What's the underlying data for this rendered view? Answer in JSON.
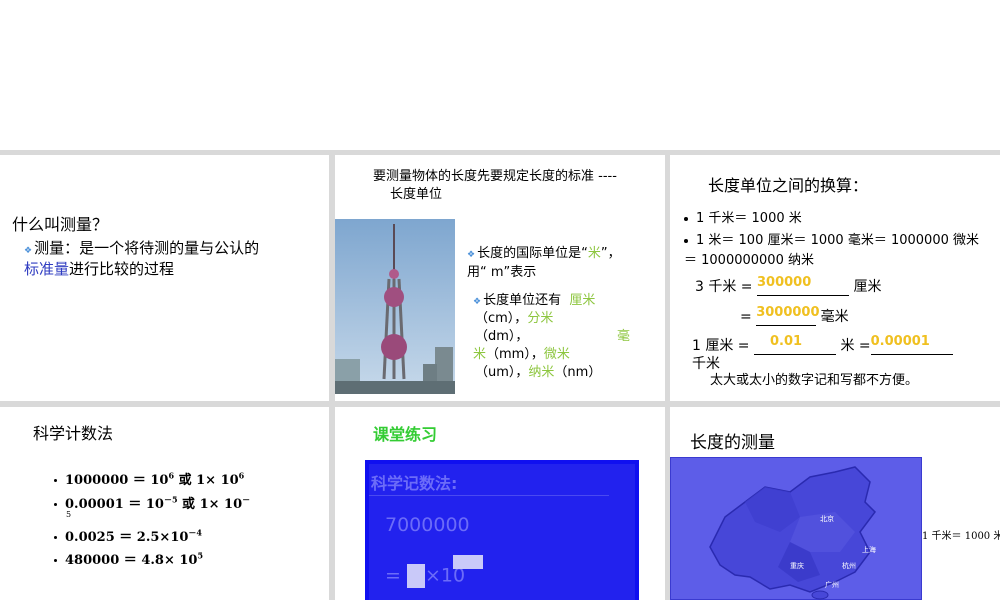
{
  "colors": {
    "accent_green": "#8dc63f",
    "link_blue": "#2f3cc1",
    "fill_yellow": "#f0c020",
    "heading_green": "#33cc33",
    "panel_blue": "#1010f0"
  },
  "slide1": {
    "title": "什么叫测量？",
    "line1": "测量：是一个将待测的量与公认的",
    "highlight": "标准量",
    "line2_rest": "进行比较的过程"
  },
  "slide2": {
    "header_line1": "要测量物体的长度先要规定长度的标准 ----",
    "header_line2": "长度单位",
    "photo_icon": "tv-tower-photo",
    "unit_intro_a": "长度的国际单位是“",
    "unit_intro_mi": "米",
    "unit_intro_b": "”，",
    "unit_intro_c": "用“ m”表示",
    "more_units": "长度单位还有",
    "cm_cn": "厘米",
    "cm_en": "（cm），",
    "dm_cn": "分米",
    "dm_en": "（dm），",
    "mm_cn_a": "毫",
    "mm_cn_b": "米",
    "mm_en": "（mm），",
    "um_cn": "微米",
    "um_en": "（um），",
    "nm_cn": "纳米",
    "nm_en": "（nm）"
  },
  "slide3": {
    "title": "长度单位之间的换算：",
    "item1": "1 千米＝ 1000 米",
    "item2a": "1 米＝ 100 厘米＝ 1000 毫米＝ 1000000 微米",
    "item2b": "＝ 1000000000 纳米",
    "q1_prefix": "3 千米 =",
    "q1_answer": "300000",
    "q1_unit": "厘米",
    "q2_prefix": "=",
    "q2_answer": "3000000",
    "q2_unit": "毫米",
    "q3_prefix": "1 厘米 =",
    "q3_answer1": "0.01",
    "q3_mid": "米 =",
    "q3_answer2": "0.00001",
    "q3_unit": "千米",
    "note": "太大或太小的数字记和写都不方便。"
  },
  "slide4": {
    "title": "科学计数法",
    "items": [
      {
        "lhs": "1000000 ＝ 10",
        "sup": "6",
        "mid": " 或 1× 10",
        "sup2": "6",
        "tail": ""
      },
      {
        "lhs": "0.00001 ＝ 10",
        "sup": "－5",
        "mid": " 或 1× 10",
        "sup2": "－",
        "tail": "5"
      },
      {
        "lhs": "0.0025 ＝   2.5×10",
        "sup": "－4",
        "mid": "",
        "sup2": "",
        "tail": ""
      },
      {
        "lhs": "480000 ＝ 4.8× 10",
        "sup": "5",
        "mid": "",
        "sup2": "",
        "tail": ""
      }
    ]
  },
  "slide5": {
    "title": "课堂练习",
    "panel_heading": "科学记数法:",
    "panel_number": "7000000",
    "panel_eq": "=",
    "panel_times": "×10"
  },
  "slide6": {
    "title": "长度的测量",
    "map_icon": "china-map",
    "side_note": "1 千米＝ 1000 米",
    "city_labels": [
      "北京",
      "上海",
      "杭州",
      "重庆",
      "广州"
    ]
  }
}
